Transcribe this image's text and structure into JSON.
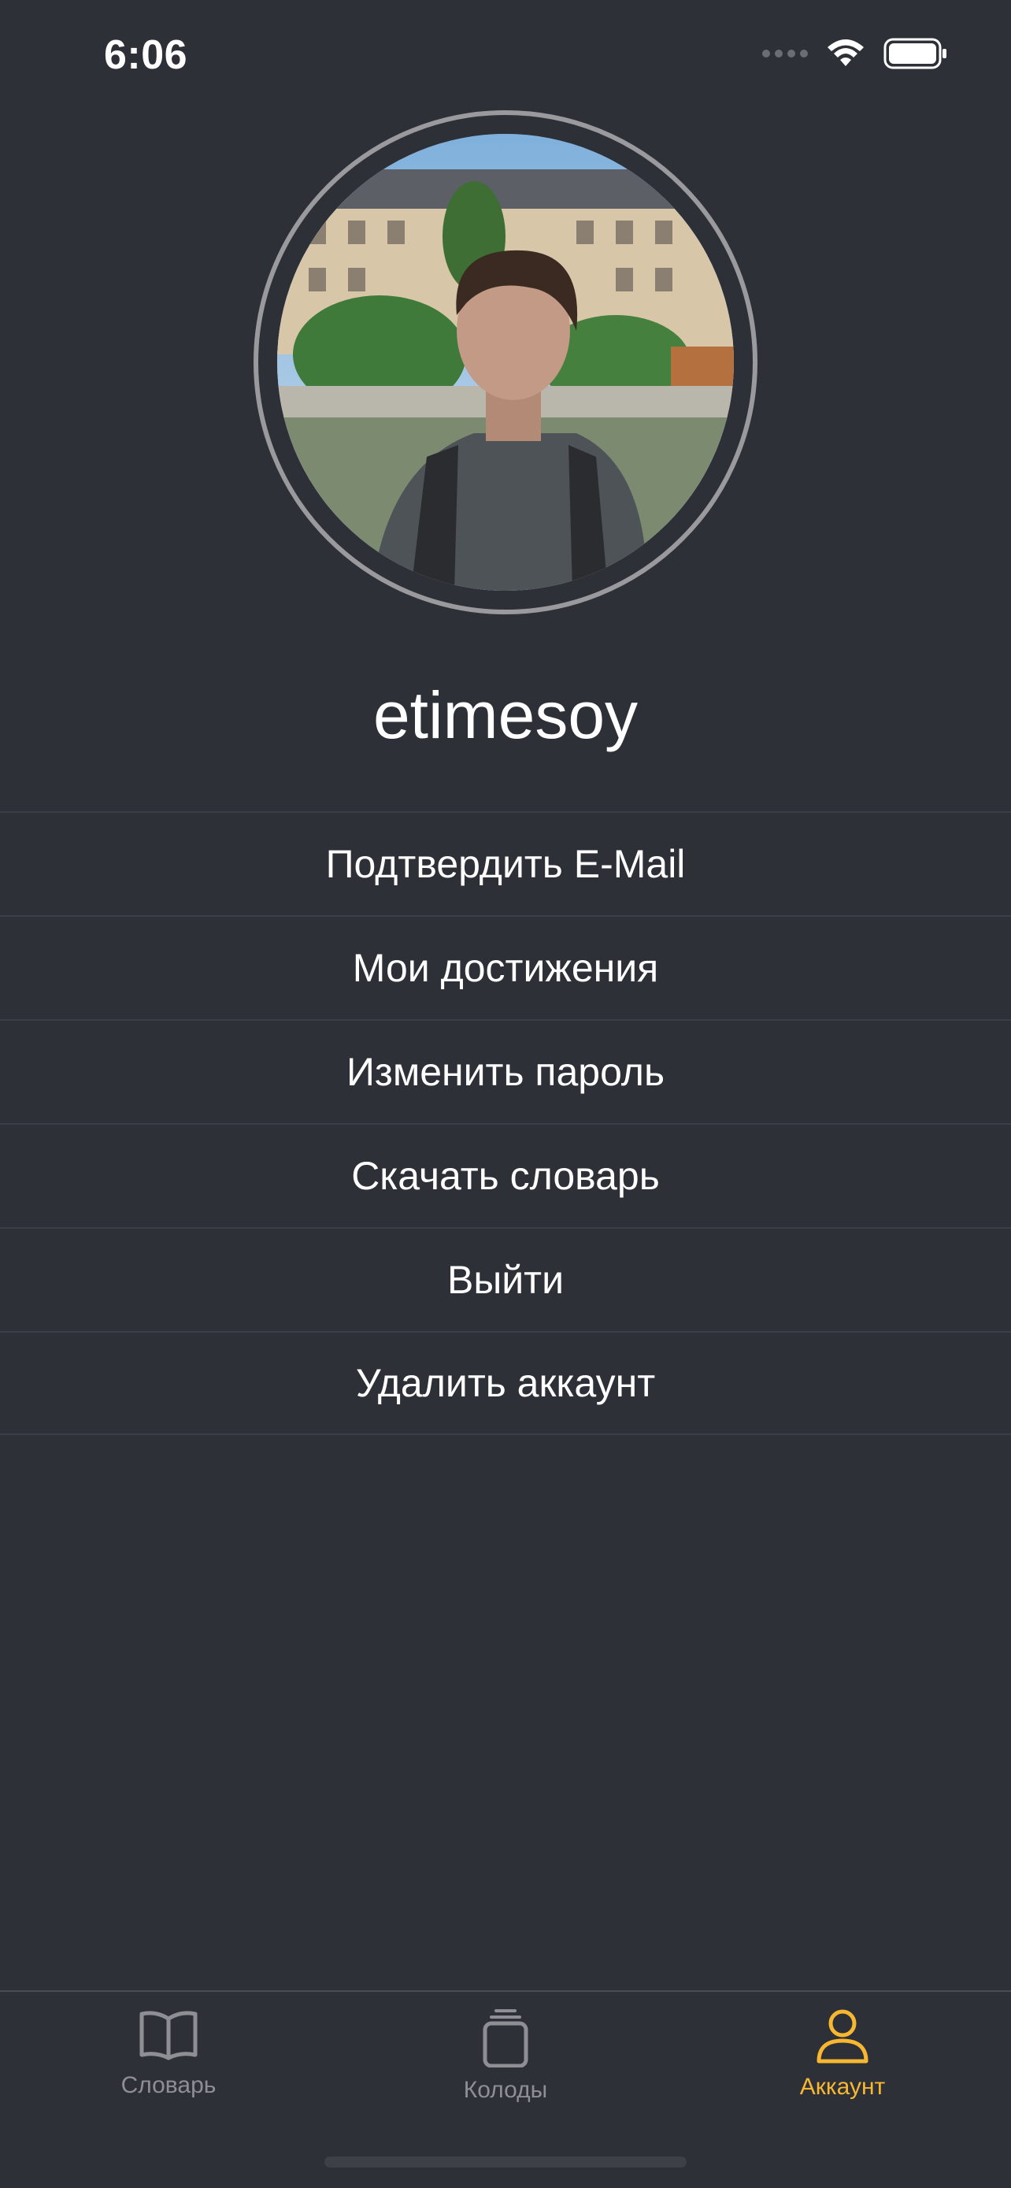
{
  "status_bar": {
    "time": "6:06",
    "icons": [
      "cellular-signal-icon",
      "wifi-icon",
      "battery-icon"
    ]
  },
  "profile": {
    "avatar": "user-photo",
    "username": "etimesoy"
  },
  "menu": {
    "items": [
      {
        "label": "Подтвердить E-Mail"
      },
      {
        "label": "Мои достижения"
      },
      {
        "label": "Изменить пароль"
      },
      {
        "label": "Скачать словарь"
      },
      {
        "label": "Выйти"
      },
      {
        "label": "Удалить аккаунт"
      }
    ]
  },
  "tabbar": {
    "tabs": [
      {
        "label": "Словарь",
        "icon": "book-icon",
        "active": false
      },
      {
        "label": "Колоды",
        "icon": "cards-stack-icon",
        "active": false
      },
      {
        "label": "Аккаунт",
        "icon": "person-icon",
        "active": true
      }
    ],
    "active_color": "#f7b731",
    "inactive_color": "#8e8f94"
  },
  "colors": {
    "background": "#2e3038",
    "separator": "#3b3e46",
    "text": "#ffffff"
  }
}
